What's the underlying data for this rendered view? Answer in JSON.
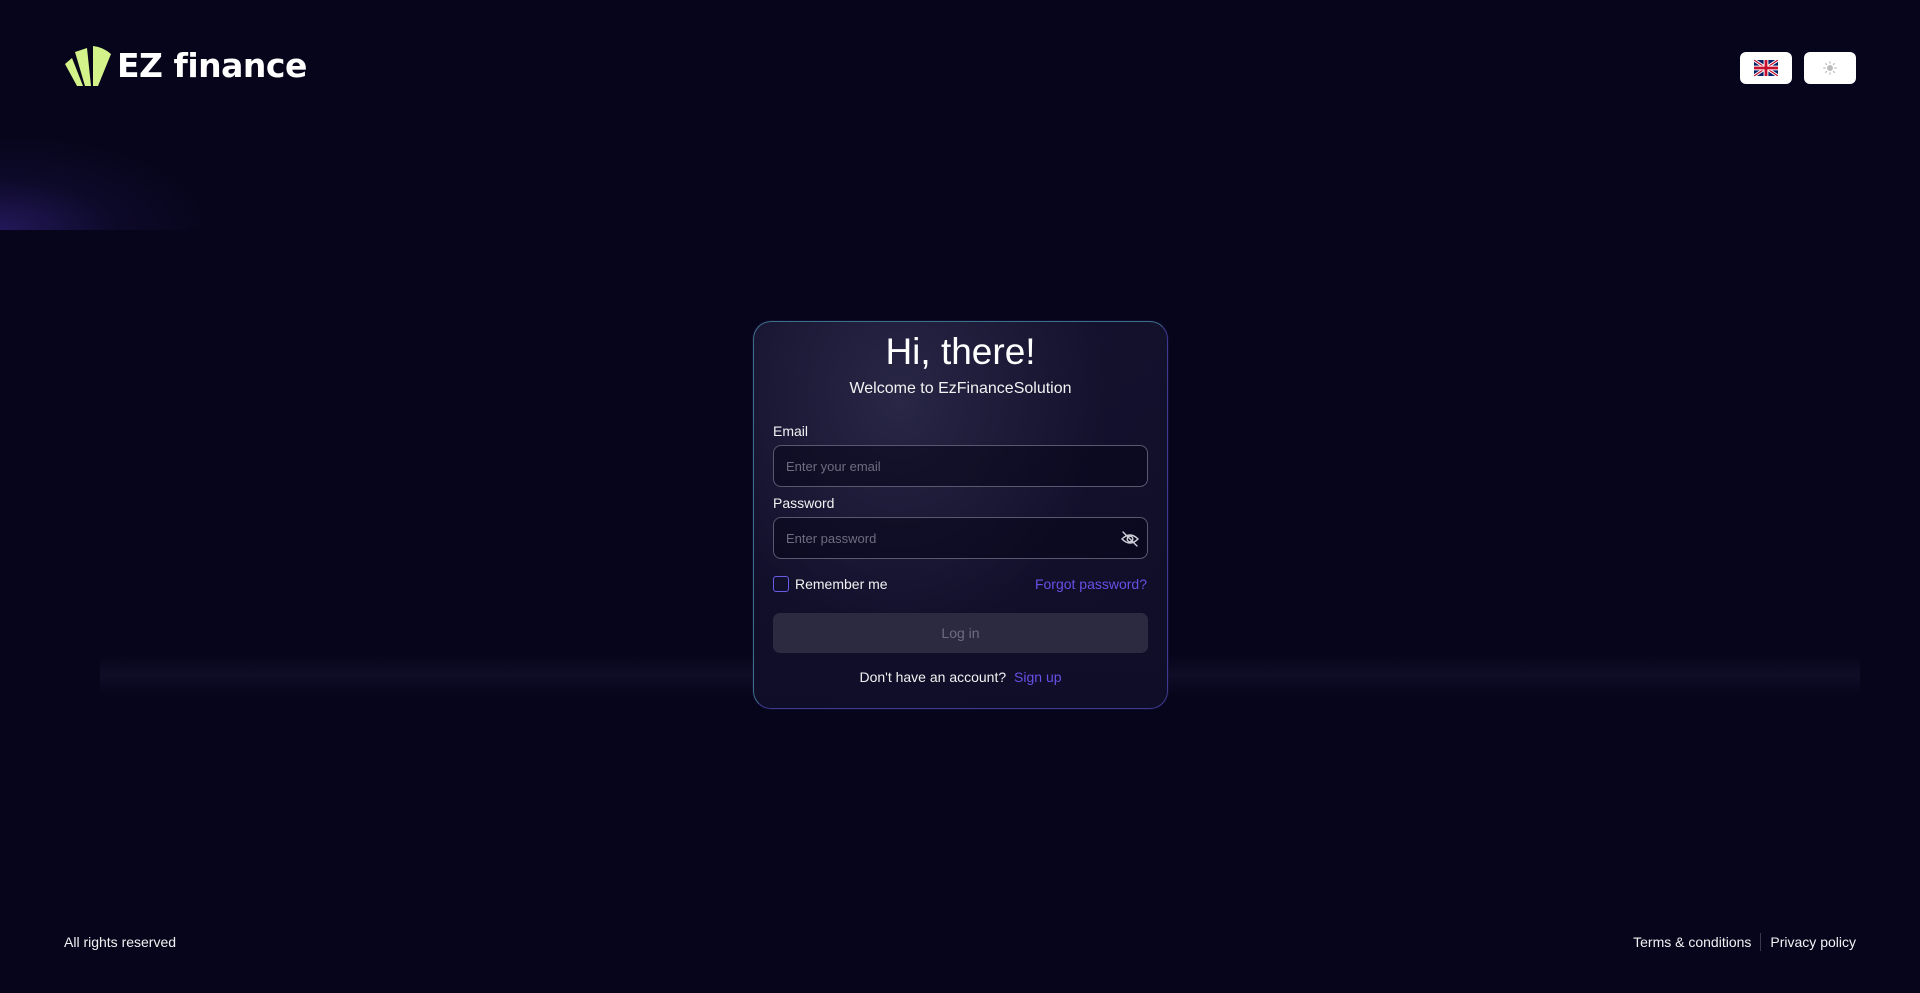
{
  "header": {
    "logo_text": "EZ finance",
    "logo_icon": "leaf-fan-logo",
    "language_icon": "uk-flag-icon",
    "theme_icon": "sun-icon"
  },
  "login": {
    "title": "Hi, there!",
    "subtitle": "Welcome to EzFinanceSolution",
    "email_label": "Email",
    "email_placeholder": "Enter your email",
    "email_value": "",
    "password_label": "Password",
    "password_placeholder": "Enter password",
    "password_value": "",
    "password_toggle_icon": "eye-off-icon",
    "remember_label": "Remember me",
    "remember_checked": false,
    "forgot_label": "Forgot password?",
    "login_button": "Log in",
    "signup_prompt": "Don't have an account?",
    "signup_link": "Sign up"
  },
  "footer": {
    "rights": "All rights reserved",
    "terms": "Terms & conditions",
    "privacy": "Privacy policy"
  },
  "colors": {
    "background": "#07051c",
    "accent": "#6a4fe8",
    "logo_green": "#d4f28a",
    "card_border": "#3f3a8e",
    "button_disabled": "#2c2a40"
  }
}
